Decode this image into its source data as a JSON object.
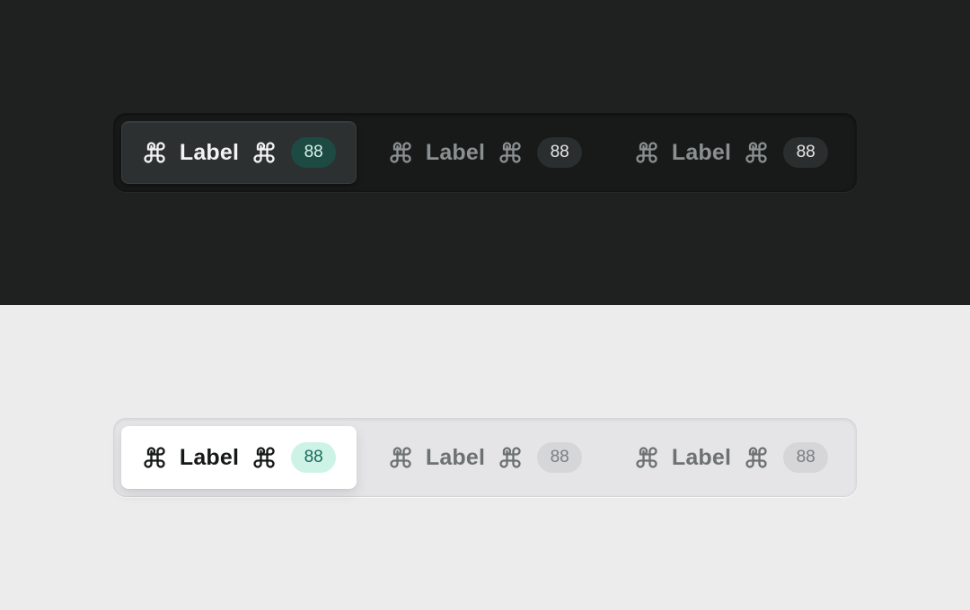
{
  "dark": {
    "segments": [
      {
        "label": "Label",
        "badge": "88",
        "active": true
      },
      {
        "label": "Label",
        "badge": "88",
        "active": false
      },
      {
        "label": "Label",
        "badge": "88",
        "active": false
      }
    ]
  },
  "light": {
    "segments": [
      {
        "label": "Label",
        "badge": "88",
        "active": true
      },
      {
        "label": "Label",
        "badge": "88",
        "active": false
      },
      {
        "label": "Label",
        "badge": "88",
        "active": false
      }
    ]
  },
  "icons": {
    "leading": "command-icon",
    "trailing": "command-icon"
  },
  "colors": {
    "dark_bg": "#1f2121",
    "light_bg": "#ececed",
    "accent_badge_dark": "#1d4a43",
    "accent_badge_light": "#cdf3e7",
    "accent_text_light": "#1d6a58"
  }
}
